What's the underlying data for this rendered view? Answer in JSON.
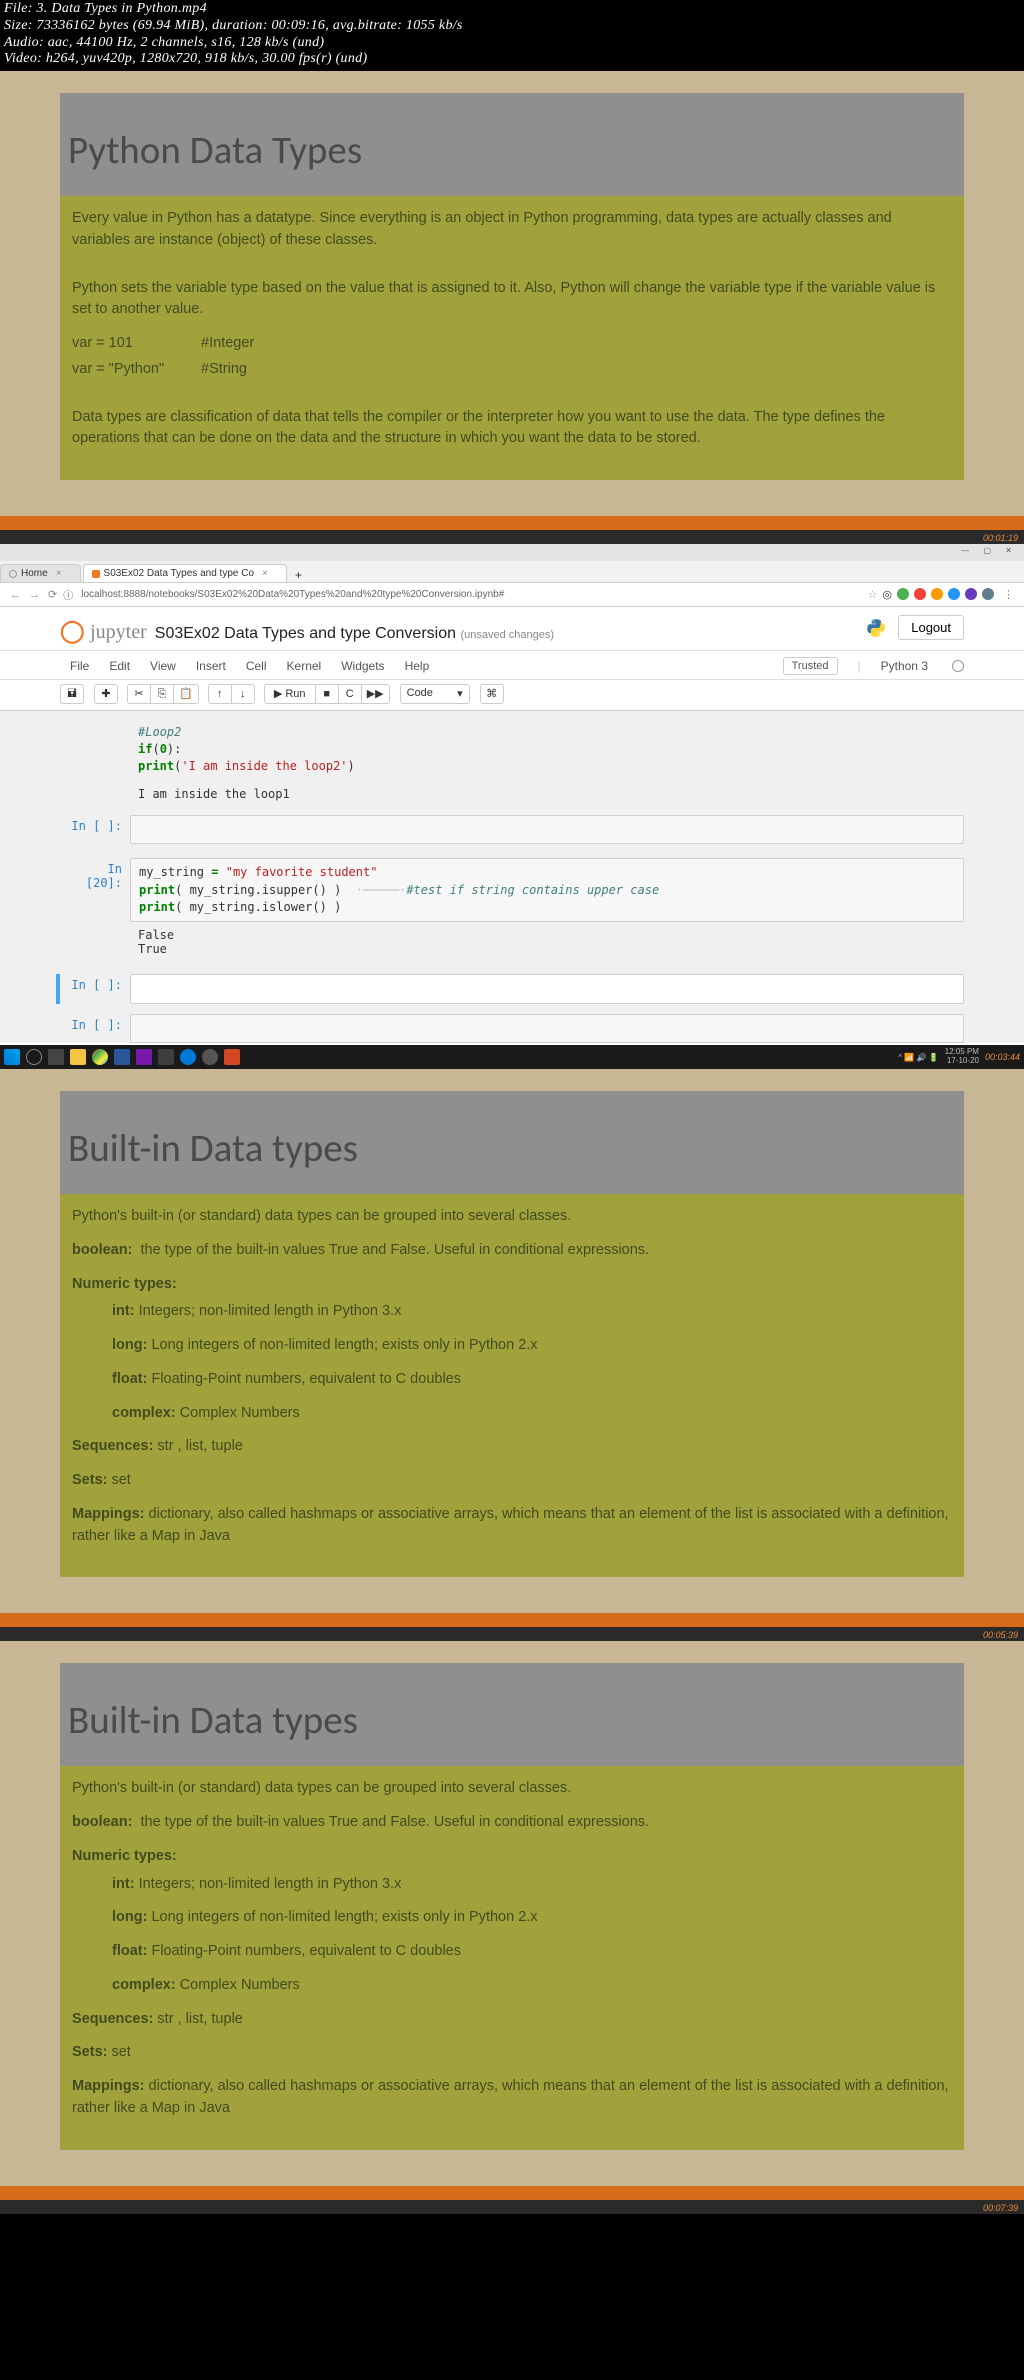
{
  "fileinfo": {
    "l1": "File: 3. Data Types in Python.mp4",
    "l2": "Size: 73336162 bytes (69.94 MiB), duration: 00:09:16, avg.bitrate: 1055 kb/s",
    "l3": "Audio: aac, 44100 Hz, 2 channels, s16, 128 kb/s (und)",
    "l4": "Video: h264, yuv420p, 1280x720, 918 kb/s, 30.00 fps(r) (und)"
  },
  "slide1": {
    "title": "Python Data Types",
    "p1": "Every value in Python has a datatype. Since everything is an object in Python programming, data types are actually classes and variables are instance (object) of these classes.",
    "p2": "Python sets the variable type based on the value that is assigned to it. Also, Python will change the variable type if the variable value is set to another value.",
    "ex1a": "var = 101",
    "ex1b": "#Integer",
    "ex2a": "var = \"Python\"",
    "ex2b": "#String",
    "p3": "Data types are classification of data that tells the compiler or the interpreter how you want to use the data. The type defines the operations that can be done on the data and the structure in which you want the data to be stored."
  },
  "ts1": "00:01:19",
  "browser": {
    "tab1": "Home",
    "tab2": "S03Ex02 Data Types and type Co",
    "url": "localhost:8888/notebooks/S03Ex02%20Data%20Types%20and%20type%20Conversion.ipynb#",
    "jupyter_label": "jupyter",
    "nb_title": "S03Ex02 Data Types and type Conversion",
    "unsaved": "(unsaved changes)",
    "logout": "Logout",
    "menu": {
      "file": "File",
      "edit": "Edit",
      "view": "View",
      "insert": "Insert",
      "cell": "Cell",
      "kernel": "Kernel",
      "widgets": "Widgets",
      "help": "Help"
    },
    "trusted": "Trusted",
    "kernel_name": "Python 3",
    "toolbar": {
      "save": "🖬",
      "add": "✚",
      "cut": "✂",
      "copy": "⎘",
      "paste": "📋",
      "up": "↑",
      "down": "↓",
      "run": "▶ Run",
      "stop": "■",
      "restart": "C",
      "rerun": "▶▶",
      "celltype": "Code",
      "cmd": "⌘"
    }
  },
  "nb": {
    "code1": {
      "c1": "#Loop2",
      "c2a": "if",
      "c2b": "(",
      "c2c": "0",
      "c2d": "):",
      "c3a": "    ",
      "c3b": "print",
      "c3c": "(",
      "c3d": "'I am inside the loop2'",
      "c3e": ")"
    },
    "out1": "I am inside the loop1",
    "empty_prompt": "In [ ]:",
    "prompt20": "In [20]:",
    "code2": {
      "l1a": "my_string ",
      "l1b": "=",
      "l1c": " ",
      "l1d": "\"my favorite student\"",
      "l2a": "print",
      "l2b": "( my_string.isupper() )",
      "l2c": "#test if string contains upper case",
      "l3a": "print",
      "l3b": "( my_string.islower() )"
    },
    "out2": "False\nTrue"
  },
  "taskbar": {
    "clock": "12:05 PM",
    "date": "17-10-20",
    "ts": "00:03:44"
  },
  "slide_bi": {
    "title": "Built-in Data types",
    "intro": "Python's built-in (or standard) data types can be grouped into several classes.",
    "bool_lbl": "boolean:",
    "bool_txt": " the type of the built-in values True and False. Useful in conditional expressions.",
    "num_lbl": "Numeric types:",
    "int_lbl": "int:",
    "int_txt": " Integers; non-limited length in Python 3.x",
    "long_lbl": "long:",
    "long_txt": " Long integers of non-limited length; exists only in Python 2.x",
    "float_lbl": "float:",
    "float_txt": " Floating-Point numbers, equivalent to C doubles",
    "cx_lbl": "complex:",
    "cx_txt": " Complex Numbers",
    "seq_lbl": "Sequences:",
    "seq_txt": " str , list, tuple",
    "set_lbl": "Sets:",
    "set_txt": " set",
    "map_lbl": "Mappings:",
    "map_txt": " dictionary, also called hashmaps or associative arrays, which means that an element of the list is associated with a definition, rather like a Map in Java"
  },
  "ts2": "00:05:39",
  "ts3": "00:07:39"
}
